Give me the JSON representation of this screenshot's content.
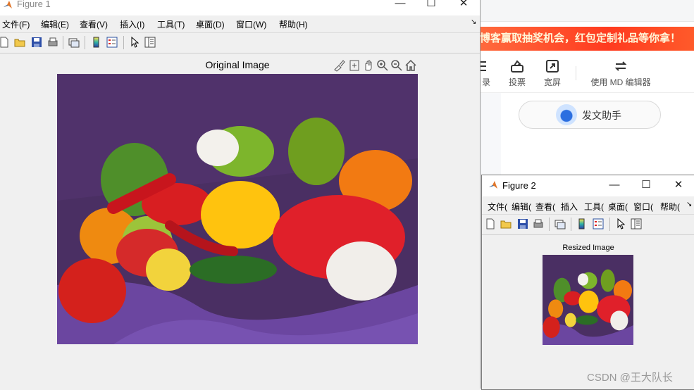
{
  "browser": {
    "banner_text": "博客赢取抽奖机会，红包定制礼品等你拿！",
    "tools": [
      {
        "label": "目录",
        "icon": "list-icon"
      },
      {
        "label": "投票",
        "icon": "vote-icon"
      },
      {
        "label": "宽屏",
        "icon": "widescreen-icon"
      },
      {
        "label": "使用 MD 编辑器",
        "icon": "switch-editor-icon"
      }
    ],
    "assistant_label": "发文助手",
    "watermark": "CSDN @王大队长"
  },
  "figure1": {
    "title": "Figure 1",
    "menus": [
      "文件(F)",
      "编辑(E)",
      "查看(V)",
      "插入(I)",
      "工具(T)",
      "桌面(D)",
      "窗口(W)",
      "帮助(H)"
    ],
    "menu_arrow": "↘",
    "toolbar_icons": [
      "new-figure-icon",
      "open-file-icon",
      "save-icon",
      "print-icon",
      "link-plot-icon",
      "colorbar-icon",
      "legend-icon",
      "pointer-icon",
      "property-inspector-icon"
    ],
    "axes_toolbar_icons": [
      "brush-icon",
      "datatip-icon",
      "pan-icon",
      "zoom-in-icon",
      "zoom-out-icon",
      "home-icon"
    ],
    "plot_title": "Original Image"
  },
  "figure2": {
    "title": "Figure 2",
    "menus": [
      "文件(",
      "编辑(",
      "查看(",
      "插入",
      "工具(",
      "桌面(",
      "窗口(",
      "帮助("
    ],
    "menu_arrow": "↘",
    "toolbar_icons": [
      "new-figure-icon",
      "open-file-icon",
      "save-icon",
      "print-icon",
      "link-plot-icon",
      "colorbar-icon",
      "legend-icon",
      "pointer-icon",
      "property-inspector-icon"
    ],
    "plot_title": "Resized Image"
  },
  "window_buttons": {
    "minimize": "—",
    "maximize": "☐",
    "close": "✕"
  },
  "colors": {
    "banner": "#ff4a26",
    "matlab_bg": "#f0f0f0",
    "photo_background": "#4a2f63"
  }
}
